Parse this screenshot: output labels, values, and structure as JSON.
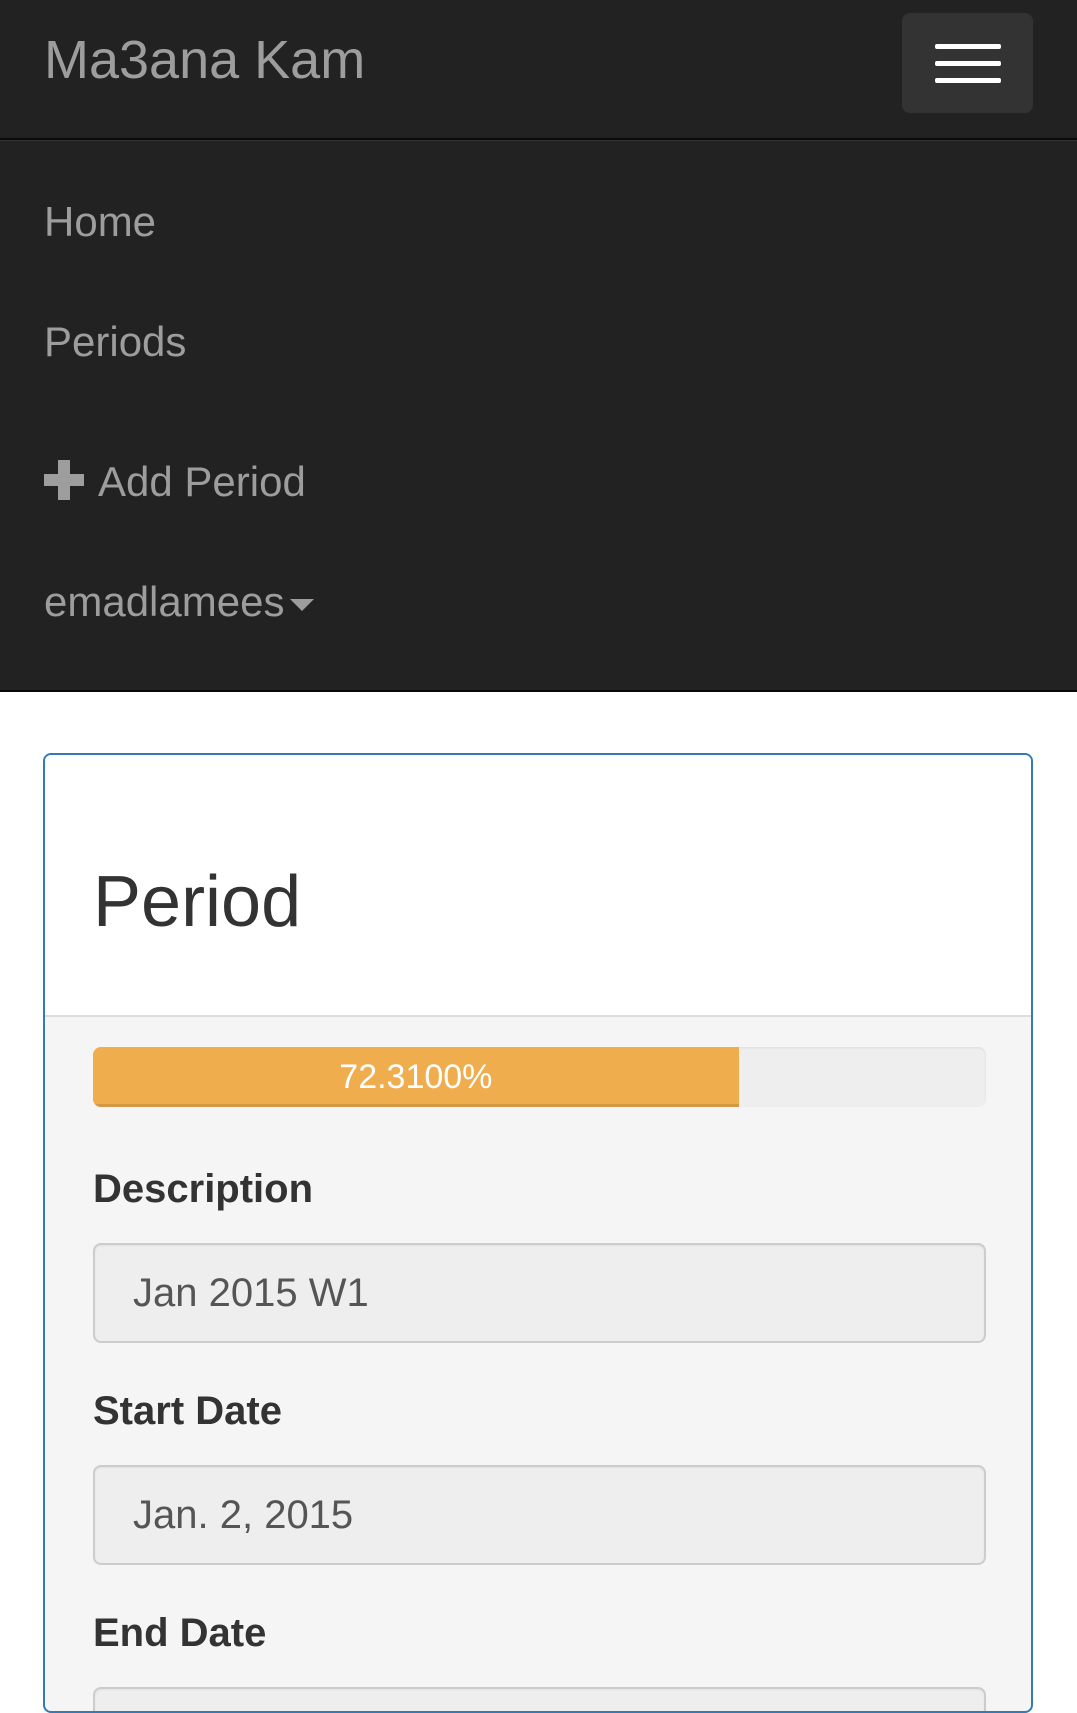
{
  "navbar": {
    "brand": "Ma3ana Kam",
    "items": [
      {
        "label": "Home"
      },
      {
        "label": "Periods"
      },
      {
        "label": "Add Period",
        "icon": "plus-icon"
      },
      {
        "label": "emadlamees",
        "icon": "caret-down-icon"
      }
    ]
  },
  "panel": {
    "title": "Period",
    "progress": {
      "value_percent": 72.31,
      "label": "72.3100%",
      "color": "#f0ad4e"
    },
    "fields": [
      {
        "label": "Description",
        "value": "Jan 2015 W1"
      },
      {
        "label": "Start Date",
        "value": "Jan. 2, 2015"
      },
      {
        "label": "End Date",
        "value": ""
      }
    ]
  },
  "colors": {
    "navbar_bg": "#222222",
    "nav_text": "#9d9d9d",
    "panel_border": "#337ab7",
    "progress_warning": "#f0ad4e"
  }
}
